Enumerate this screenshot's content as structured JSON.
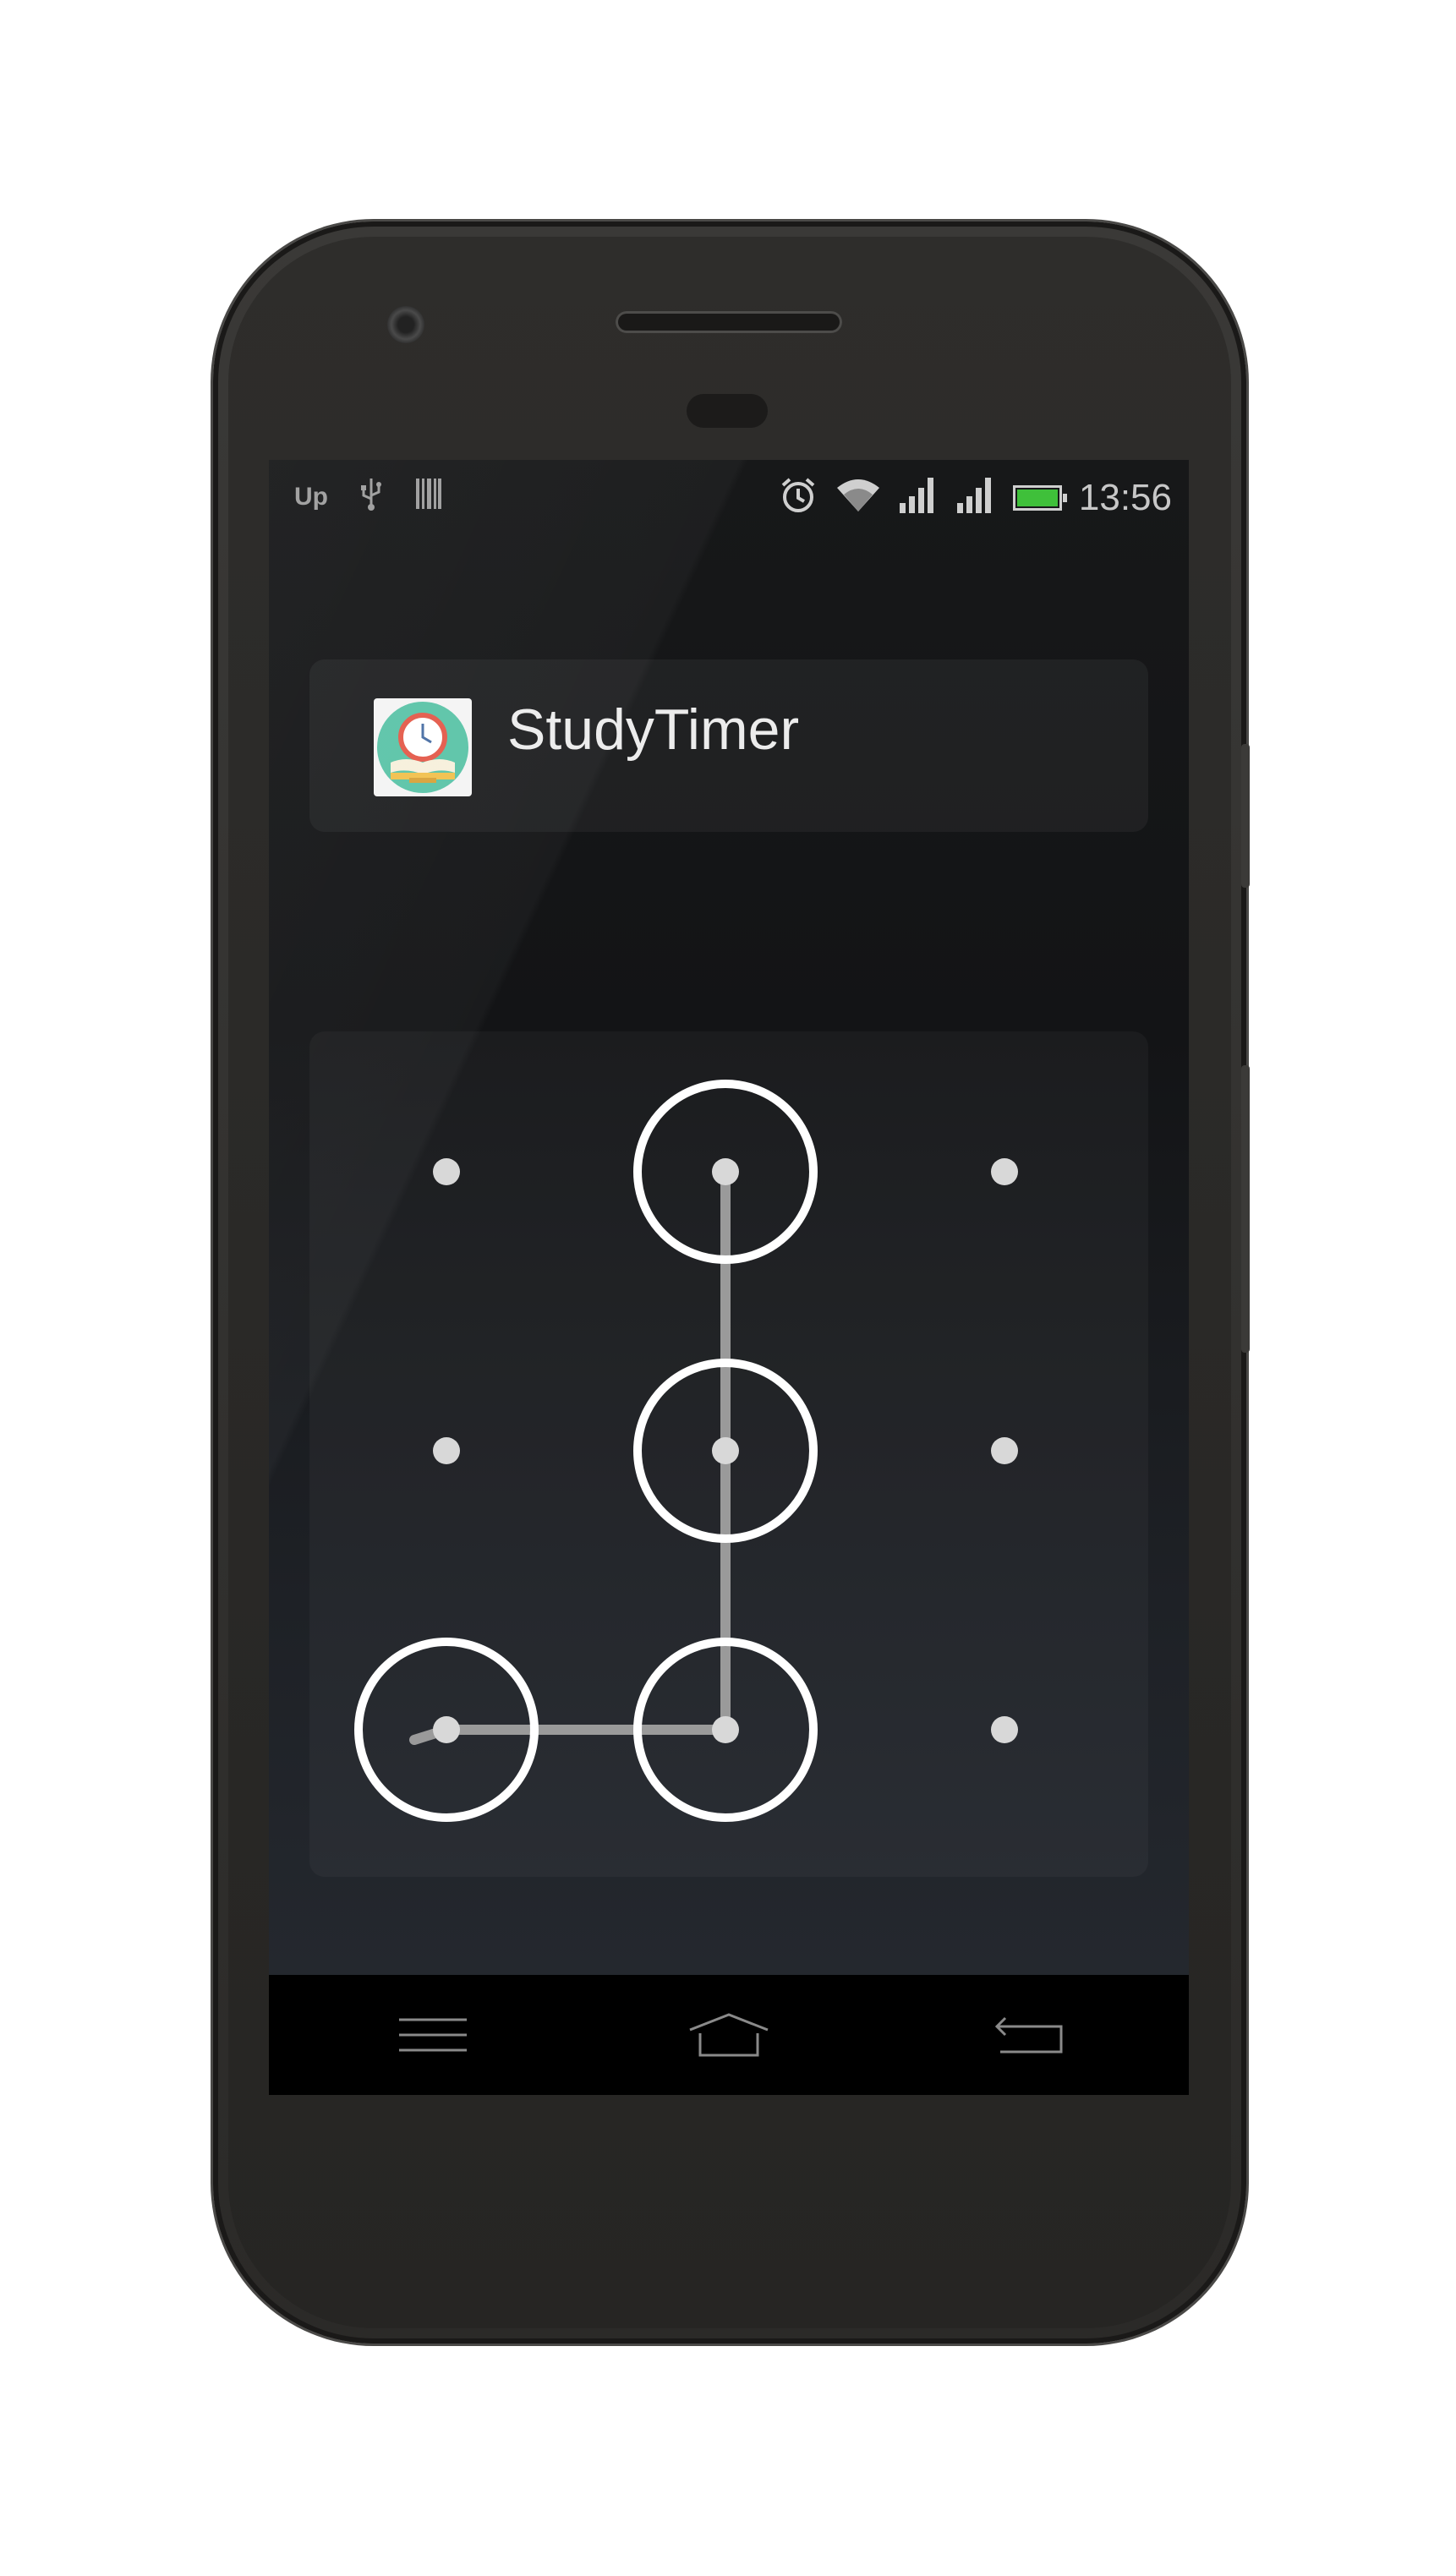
{
  "statusbar": {
    "left_icons": [
      "upwork-icon",
      "usb-icon",
      "barcode-icon"
    ],
    "upwork_text": "Up",
    "right_icons": [
      "alarm-icon",
      "wifi-icon",
      "signal-icon",
      "signal-icon",
      "battery-icon"
    ],
    "time": "13:56",
    "battery_color": "#3fc03a"
  },
  "app": {
    "name": "StudyTimer",
    "icon": "study-timer-app-icon",
    "icon_colors": {
      "circle": "#5cc4a8",
      "clock": "#e45b4b",
      "book": "#f2c14e"
    }
  },
  "pattern": {
    "grid_size": 3,
    "selected_dots": [
      {
        "row": 0,
        "col": 1
      },
      {
        "row": 1,
        "col": 1
      },
      {
        "row": 2,
        "col": 1
      },
      {
        "row": 2,
        "col": 0
      }
    ],
    "line_color": "#9a9a9a",
    "ring_color": "#ffffff",
    "dot_color": "#d8d8d8"
  },
  "navbar": {
    "buttons": [
      "menu-icon",
      "home-icon",
      "back-icon"
    ]
  }
}
